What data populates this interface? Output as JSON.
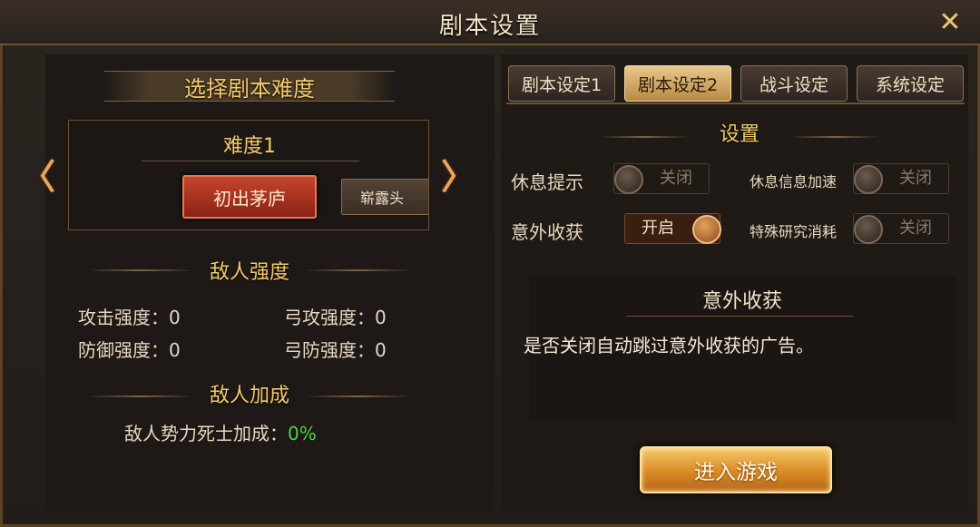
{
  "window": {
    "title": "剧本设置",
    "close_glyph": "✕",
    "accent": "#f3c96b"
  },
  "left": {
    "difficulty_header": "选择剧本难度",
    "difficulty_name": "难度1",
    "selected_option": "初出茅庐",
    "next_option": "崭露头",
    "prev_arrow": "〈",
    "next_arrow": "〉",
    "enemy_strength_header": "敌人强度",
    "stats": [
      {
        "label": "攻击强度：",
        "value": "0"
      },
      {
        "label": "弓攻强度：",
        "value": "0"
      },
      {
        "label": "防御强度：",
        "value": "0"
      },
      {
        "label": "弓防强度：",
        "value": "0"
      }
    ],
    "enemy_bonus_header": "敌人加成",
    "bonus_label": "敌人势力死士加成：",
    "bonus_value": "0%"
  },
  "right": {
    "tabs": [
      {
        "label": "剧本设定1",
        "active": false
      },
      {
        "label": "剧本设定2",
        "active": true
      },
      {
        "label": "战斗设定",
        "active": false
      },
      {
        "label": "系统设定",
        "active": false
      }
    ],
    "settings_header": "设置",
    "settings": [
      {
        "label": "休息提示",
        "state": "关闭",
        "on": false
      },
      {
        "label": "休息信息加速",
        "state": "关闭",
        "on": false
      },
      {
        "label": "意外收获",
        "state": "开启",
        "on": true
      },
      {
        "label": "特殊研究消耗",
        "state": "关闭",
        "on": false
      }
    ],
    "info_title": "意外收获",
    "info_text": "是否关闭自动跳过意外收获的广告。",
    "enter_button": "进入游戏"
  }
}
